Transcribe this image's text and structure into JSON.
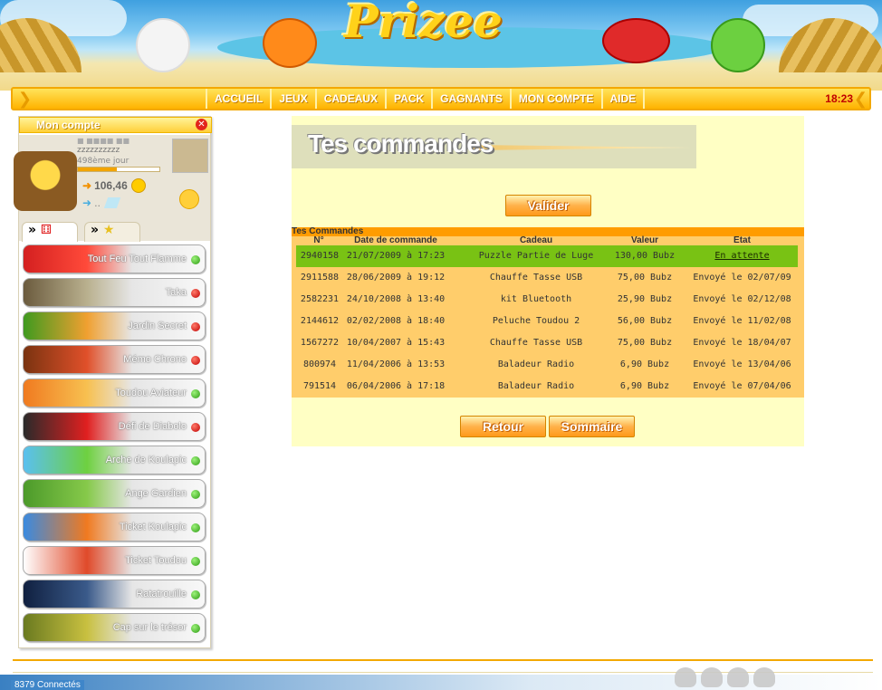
{
  "brand": {
    "logo": "Prizee"
  },
  "nav": {
    "items": [
      "ACCUEIL",
      "JEUX",
      "CADEAUX",
      "PACK",
      "GAGNANTS",
      "MON COMPTE",
      "AIDE"
    ],
    "clock": "18:23"
  },
  "sidebar": {
    "title": "Mon compte",
    "username": "■ ■■■■ ■■",
    "user_z": "zzzzzzzzzz",
    "day": "498ème jour",
    "xp_fraction": 0.48,
    "coins": "106,46",
    "gems": "..",
    "games": [
      {
        "label": "Tout Feu Tout Flamme",
        "status": "green",
        "c1": "#d42020",
        "c2": "#ff4a3a"
      },
      {
        "label": "Taka",
        "status": "red",
        "c1": "#6b5b3e",
        "c2": "#b9b08e"
      },
      {
        "label": "Jardin Secret",
        "status": "red",
        "c1": "#3f9a1f",
        "c2": "#f0a030"
      },
      {
        "label": "Mémo Chrono",
        "status": "red",
        "c1": "#7a3310",
        "c2": "#e0502a"
      },
      {
        "label": "Toudou Aviateur",
        "status": "green",
        "c1": "#f07a20",
        "c2": "#f7c050"
      },
      {
        "label": "Défi de Diabolo",
        "status": "red",
        "c1": "#2a2a2a",
        "c2": "#e02020"
      },
      {
        "label": "Arche de Koulapic",
        "status": "green",
        "c1": "#5ac0f0",
        "c2": "#6ed040"
      },
      {
        "label": "Ange Gardien",
        "status": "green",
        "c1": "#4c9a2a",
        "c2": "#86c94a"
      },
      {
        "label": "Ticket Koulapic",
        "status": "green",
        "c1": "#3a8ae0",
        "c2": "#f07a20"
      },
      {
        "label": "Ticket Toudou",
        "status": "green",
        "c1": "#ffffff",
        "c2": "#e04a2a"
      },
      {
        "label": "Ratatrouille",
        "status": "green",
        "c1": "#102040",
        "c2": "#3a5a8a"
      },
      {
        "label": "Cap sur le trésor",
        "status": "green",
        "c1": "#6a7a20",
        "c2": "#c8c040"
      }
    ]
  },
  "main": {
    "heading": "Tes commandes",
    "validate_label": "Valider",
    "back_label": "Retour",
    "summary_label": "Sommaire",
    "orders_title": "Tes Commandes",
    "columns": [
      "N°",
      "Date de commande",
      "Cadeau",
      "Valeur",
      "Etat"
    ],
    "rows": [
      {
        "n": "2940158",
        "date": "21/07/2009 à 17:23",
        "gift": "Puzzle Partie de Luge",
        "value": "130,00 Bubz",
        "state": "En attente"
      },
      {
        "n": "2911588",
        "date": "28/06/2009 à 19:12",
        "gift": "Chauffe Tasse USB",
        "value": "75,00 Bubz",
        "state": "Envoyé le 02/07/09"
      },
      {
        "n": "2582231",
        "date": "24/10/2008 à 13:40",
        "gift": "kit Bluetooth",
        "value": "25,90 Bubz",
        "state": "Envoyé le 02/12/08"
      },
      {
        "n": "2144612",
        "date": "02/02/2008 à 18:40",
        "gift": "Peluche Toudou 2",
        "value": "56,00 Bubz",
        "state": "Envoyé le 11/02/08"
      },
      {
        "n": "1567272",
        "date": "10/04/2007 à 15:43",
        "gift": "Chauffe Tasse USB",
        "value": "75,00 Bubz",
        "state": "Envoyé le 18/04/07"
      },
      {
        "n": "800974",
        "date": "11/04/2006 à 13:53",
        "gift": "Baladeur Radio",
        "value": "6,90 Bubz",
        "state": "Envoyé le 13/04/06"
      },
      {
        "n": "791514",
        "date": "06/04/2006 à 17:18",
        "gift": "Baladeur Radio",
        "value": "6,90 Bubz",
        "state": "Envoyé le 07/04/06"
      }
    ]
  },
  "footer": {
    "connected": "8379 Connectés"
  }
}
